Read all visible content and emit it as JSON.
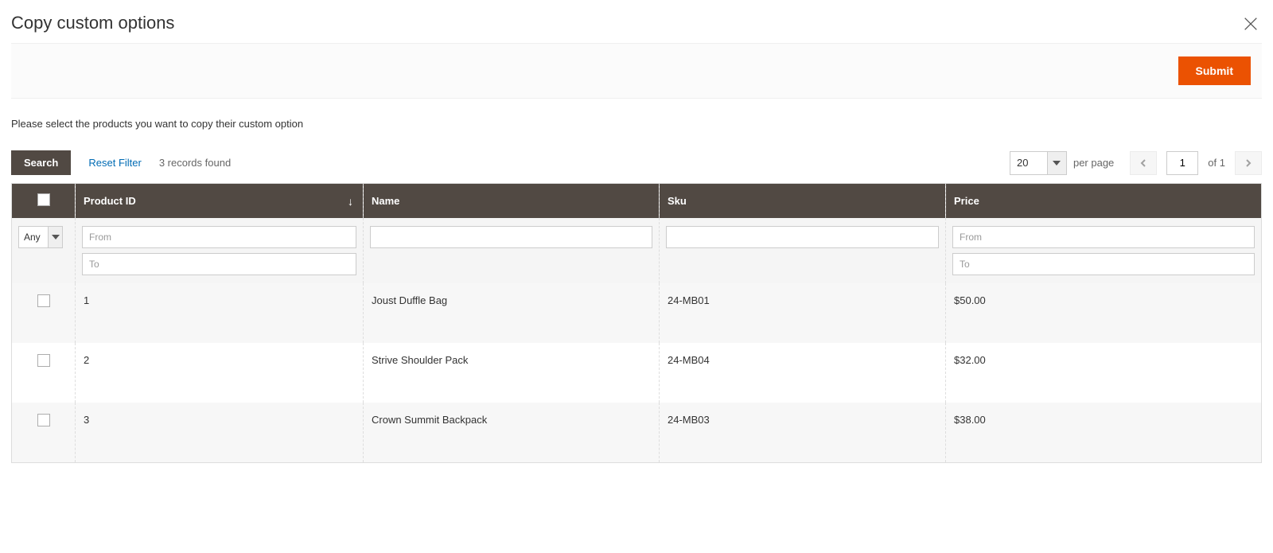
{
  "modal": {
    "title": "Copy custom options"
  },
  "actions": {
    "submit": "Submit"
  },
  "instruction": "Please select the products you want to copy their custom option",
  "grid_toolbar": {
    "search": "Search",
    "reset_filter": "Reset Filter",
    "records_found": "3 records found",
    "page_size": "20",
    "per_page_label": "per page",
    "current_page": "1",
    "of_label": "of",
    "total_pages": "1"
  },
  "columns": {
    "product_id": "Product ID",
    "name": "Name",
    "sku": "Sku",
    "price": "Price"
  },
  "filters": {
    "any_label": "Any",
    "from_placeholder": "From",
    "to_placeholder": "To"
  },
  "rows": [
    {
      "id": "1",
      "name": "Joust Duffle Bag",
      "sku": "24-MB01",
      "price": "$50.00"
    },
    {
      "id": "2",
      "name": "Strive Shoulder Pack",
      "sku": "24-MB04",
      "price": "$32.00"
    },
    {
      "id": "3",
      "name": "Crown Summit Backpack",
      "sku": "24-MB03",
      "price": "$38.00"
    }
  ]
}
